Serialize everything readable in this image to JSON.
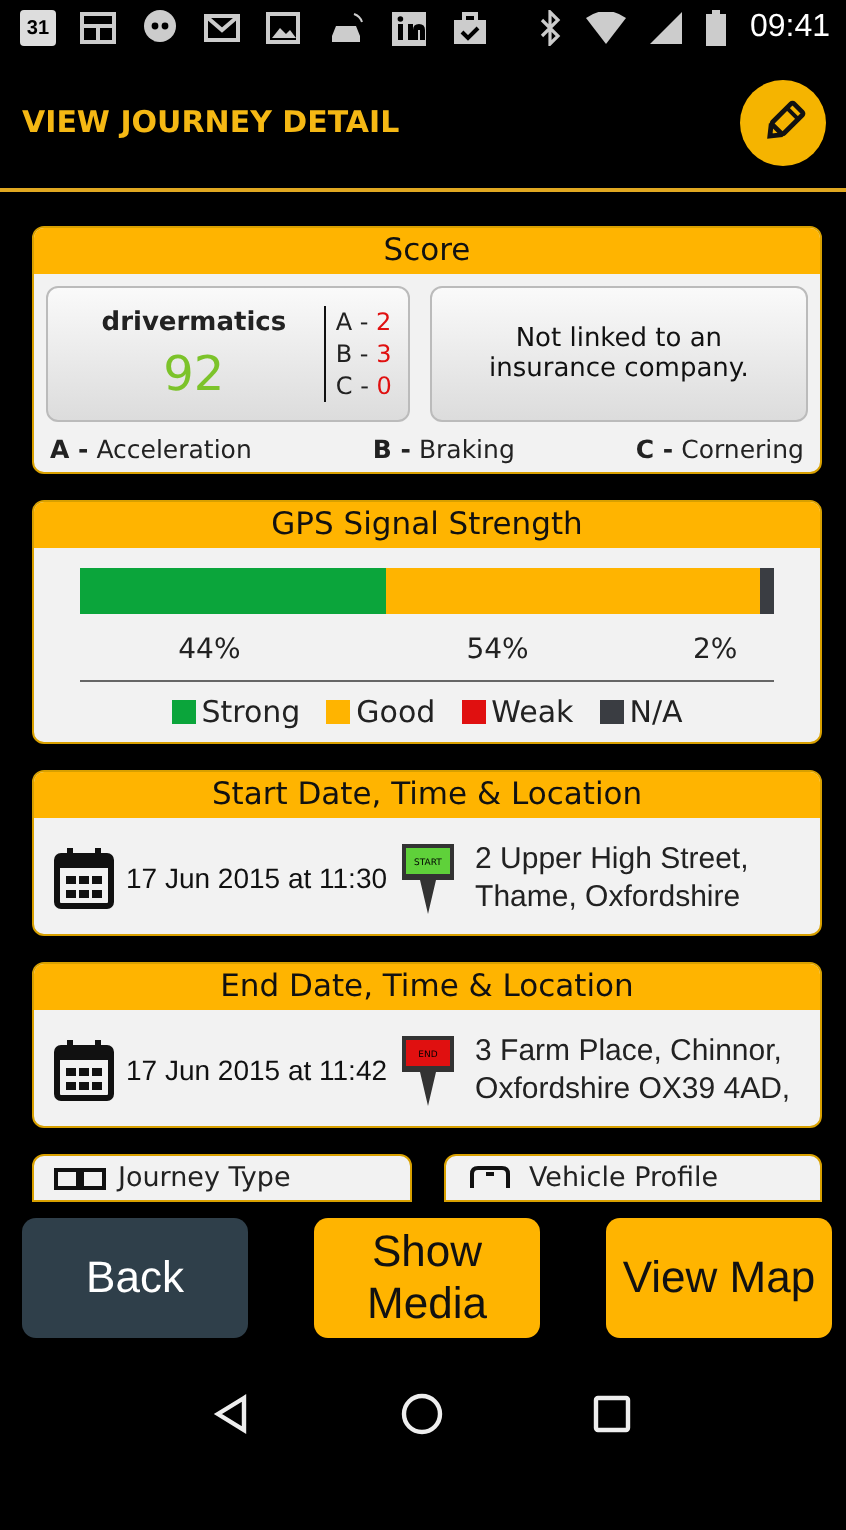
{
  "status_bar": {
    "time": "09:41",
    "calendar_day": "31"
  },
  "header": {
    "title": "VIEW JOURNEY DETAIL"
  },
  "score": {
    "title": "Score",
    "brand": "drivermatics",
    "value": "92",
    "breakdown": [
      {
        "letter": "A -",
        "value": "2"
      },
      {
        "letter": "B -",
        "value": "3"
      },
      {
        "letter": "C -",
        "value": "0"
      }
    ],
    "insurance": "Not linked to an insurance company.",
    "legend": [
      {
        "letter": "A -",
        "name": "Acceleration"
      },
      {
        "letter": "B -",
        "name": "Braking"
      },
      {
        "letter": "C -",
        "name": "Cornering"
      }
    ]
  },
  "gps": {
    "title": "GPS Signal Strength",
    "segments": [
      {
        "name": "Strong",
        "color": "#0ba53b",
        "reading": "44%"
      },
      {
        "name": "Good",
        "color": "#ffb400",
        "reading": "54%"
      },
      {
        "name": "Weak",
        "color": "#e01010"
      },
      {
        "name": "N/A",
        "color": "#3a3d42",
        "reading": "2%"
      }
    ]
  },
  "locations": [
    {
      "kind": "start",
      "title": "Start Date, Time & Location",
      "datetime": "17 Jun 2015 at 11:30",
      "pin_label": "START",
      "address": "2 Upper High Street, Thame, Oxfordshire"
    },
    {
      "kind": "end",
      "title": "End Date, Time & Location",
      "datetime": "17 Jun 2015 at 11:42",
      "pin_label": "END",
      "address": "3 Farm Place, Chinnor, Oxfordshire OX39 4AD,"
    }
  ],
  "more_cards": [
    {
      "kind": "journey",
      "label": "Journey Type"
    },
    {
      "kind": "vehicle",
      "label": "Vehicle Profile"
    }
  ],
  "buttons": [
    {
      "kind": "dark",
      "label": "Back"
    },
    {
      "kind": "accent",
      "label": "Show Media"
    },
    {
      "kind": "accent",
      "label": "View Map"
    }
  ]
}
